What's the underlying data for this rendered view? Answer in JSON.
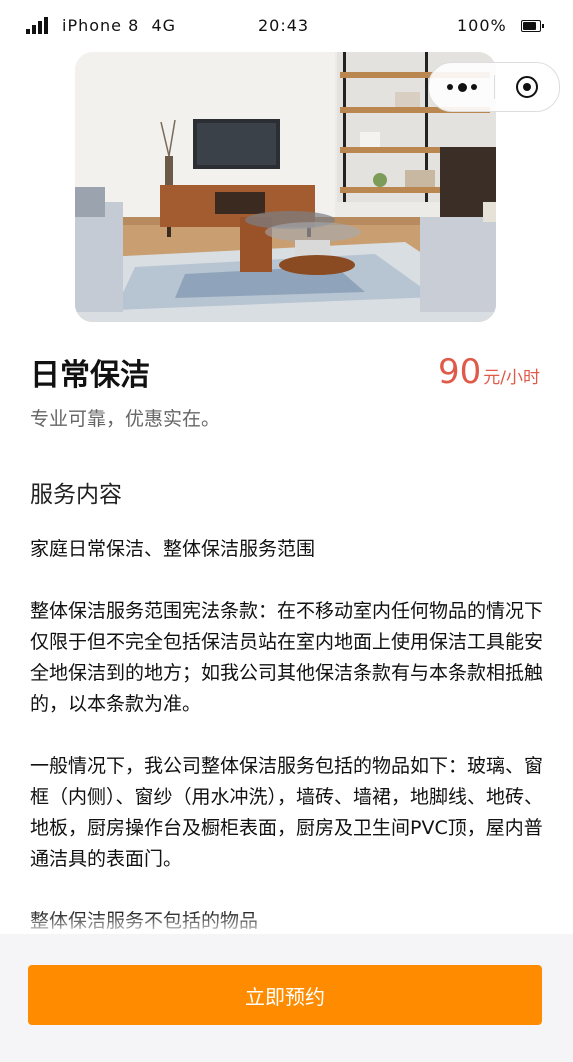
{
  "status_bar": {
    "carrier": "iPhone 8  4G",
    "time": "20:43",
    "battery": "100%"
  },
  "capsule": {
    "more_icon": "more-dots-icon",
    "record_icon": "record-target-icon"
  },
  "product": {
    "title": "日常保洁",
    "price": "90",
    "price_unit": "元/小时",
    "subtitle": "专业可靠，优惠实在。"
  },
  "service": {
    "heading": "服务内容",
    "paragraphs": [
      "家庭日常保洁、整体保洁服务范围",
      "整体保洁服务范围宪法条款：在不移动室内任何物品的情况下仅限于但不完全包括保洁员站在室内地面上使用保洁工具能安全地保洁到的地方；如我公司其他保洁条款有与本条款相抵触的，以本条款为准。",
      "一般情况下，我公司整体保洁服务包括的物品如下：玻璃、窗框（内侧）、窗纱（用水冲洗），墙砖、墙裙，地脚线、地砖、地板，厨房操作台及橱柜表面，厨房及卫生间PVC顶，屋内普通洁具的表面门。",
      "整体保洁服务不包括的物品"
    ]
  },
  "footer": {
    "book_label": "立即预约"
  },
  "colors": {
    "accent": "#ff8c00",
    "price": "#e05a4a"
  }
}
